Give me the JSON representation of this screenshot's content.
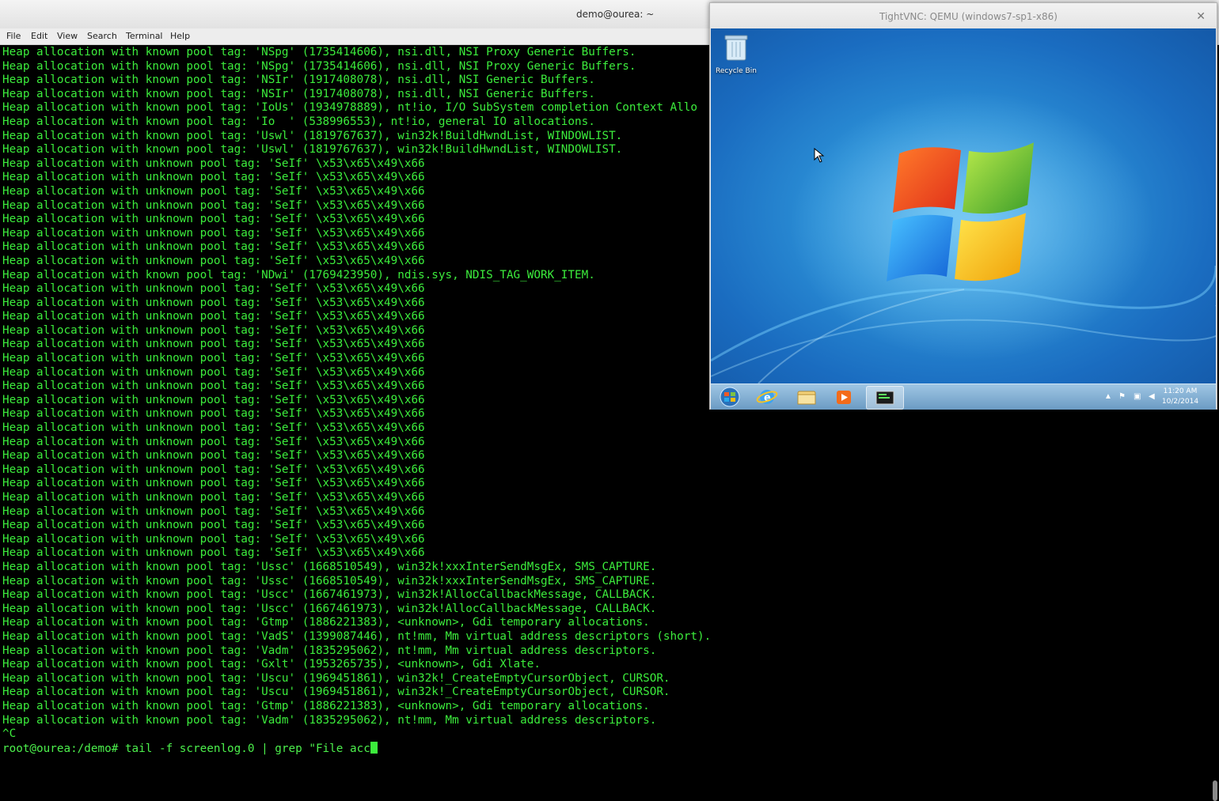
{
  "terminal": {
    "title": "demo@ourea: ~",
    "menu": [
      "File",
      "Edit",
      "View",
      "Search",
      "Terminal",
      "Help"
    ],
    "lines": [
      "Heap allocation with known pool tag: 'NSpg' (1735414606), nsi.dll, NSI Proxy Generic Buffers.",
      "Heap allocation with known pool tag: 'NSpg' (1735414606), nsi.dll, NSI Proxy Generic Buffers.",
      "Heap allocation with known pool tag: 'NSIr' (1917408078), nsi.dll, NSI Generic Buffers.",
      "Heap allocation with known pool tag: 'NSIr' (1917408078), nsi.dll, NSI Generic Buffers.",
      "Heap allocation with known pool tag: 'IoUs' (1934978889), nt!io, I/O SubSystem completion Context Allo",
      "Heap allocation with known pool tag: 'Io  ' (538996553), nt!io, general IO allocations.",
      "Heap allocation with known pool tag: 'Uswl' (1819767637), win32k!BuildHwndList, WINDOWLIST.",
      "Heap allocation with known pool tag: 'Uswl' (1819767637), win32k!BuildHwndList, WINDOWLIST.",
      "Heap allocation with unknown pool tag: 'SeIf' \\x53\\x65\\x49\\x66",
      "Heap allocation with unknown pool tag: 'SeIf' \\x53\\x65\\x49\\x66",
      "Heap allocation with unknown pool tag: 'SeIf' \\x53\\x65\\x49\\x66",
      "Heap allocation with unknown pool tag: 'SeIf' \\x53\\x65\\x49\\x66",
      "Heap allocation with unknown pool tag: 'SeIf' \\x53\\x65\\x49\\x66",
      "Heap allocation with unknown pool tag: 'SeIf' \\x53\\x65\\x49\\x66",
      "Heap allocation with unknown pool tag: 'SeIf' \\x53\\x65\\x49\\x66",
      "Heap allocation with unknown pool tag: 'SeIf' \\x53\\x65\\x49\\x66",
      "Heap allocation with known pool tag: 'NDwi' (1769423950), ndis.sys, NDIS_TAG_WORK_ITEM.",
      "Heap allocation with unknown pool tag: 'SeIf' \\x53\\x65\\x49\\x66",
      "Heap allocation with unknown pool tag: 'SeIf' \\x53\\x65\\x49\\x66",
      "Heap allocation with unknown pool tag: 'SeIf' \\x53\\x65\\x49\\x66",
      "Heap allocation with unknown pool tag: 'SeIf' \\x53\\x65\\x49\\x66",
      "Heap allocation with unknown pool tag: 'SeIf' \\x53\\x65\\x49\\x66",
      "Heap allocation with unknown pool tag: 'SeIf' \\x53\\x65\\x49\\x66",
      "Heap allocation with unknown pool tag: 'SeIf' \\x53\\x65\\x49\\x66",
      "Heap allocation with unknown pool tag: 'SeIf' \\x53\\x65\\x49\\x66",
      "Heap allocation with unknown pool tag: 'SeIf' \\x53\\x65\\x49\\x66",
      "Heap allocation with unknown pool tag: 'SeIf' \\x53\\x65\\x49\\x66",
      "Heap allocation with unknown pool tag: 'SeIf' \\x53\\x65\\x49\\x66",
      "Heap allocation with unknown pool tag: 'SeIf' \\x53\\x65\\x49\\x66",
      "Heap allocation with unknown pool tag: 'SeIf' \\x53\\x65\\x49\\x66",
      "Heap allocation with unknown pool tag: 'SeIf' \\x53\\x65\\x49\\x66",
      "Heap allocation with unknown pool tag: 'SeIf' \\x53\\x65\\x49\\x66",
      "Heap allocation with unknown pool tag: 'SeIf' \\x53\\x65\\x49\\x66",
      "Heap allocation with unknown pool tag: 'SeIf' \\x53\\x65\\x49\\x66",
      "Heap allocation with unknown pool tag: 'SeIf' \\x53\\x65\\x49\\x66",
      "Heap allocation with unknown pool tag: 'SeIf' \\x53\\x65\\x49\\x66",
      "Heap allocation with unknown pool tag: 'SeIf' \\x53\\x65\\x49\\x66",
      "Heap allocation with known pool tag: 'Ussc' (1668510549), win32k!xxxInterSendMsgEx, SMS_CAPTURE.",
      "Heap allocation with known pool tag: 'Ussc' (1668510549), win32k!xxxInterSendMsgEx, SMS_CAPTURE.",
      "Heap allocation with known pool tag: 'Uscc' (1667461973), win32k!AllocCallbackMessage, CALLBACK.",
      "Heap allocation with known pool tag: 'Uscc' (1667461973), win32k!AllocCallbackMessage, CALLBACK.",
      "Heap allocation with known pool tag: 'Gtmp' (1886221383), <unknown>, Gdi temporary allocations.",
      "Heap allocation with known pool tag: 'VadS' (1399087446), nt!mm, Mm virtual address descriptors (short).",
      "Heap allocation with known pool tag: 'Vadm' (1835295062), nt!mm, Mm virtual address descriptors.",
      "Heap allocation with known pool tag: 'Gxlt' (1953265735), <unknown>, Gdi Xlate.",
      "Heap allocation with known pool tag: 'Uscu' (1969451861), win32k!_CreateEmptyCursorObject, CURSOR.",
      "Heap allocation with known pool tag: 'Uscu' (1969451861), win32k!_CreateEmptyCursorObject, CURSOR.",
      "Heap allocation with known pool tag: 'Gtmp' (1886221383), <unknown>, Gdi temporary allocations.",
      "Heap allocation with known pool tag: 'Vadm' (1835295062), nt!mm, Mm virtual address descriptors.",
      "^C"
    ],
    "prompt": "root@ourea:/demo# ",
    "command": "tail -f screenlog.0 | grep \"File acc"
  },
  "vnc": {
    "title": "TightVNC: QEMU (windows7-sp1-x86)",
    "desktop_icons": [
      {
        "label": "Recycle Bin",
        "icon": "recycle-bin-icon"
      }
    ],
    "taskbar": {
      "buttons": [
        "start-orb-icon",
        "internet-explorer-icon",
        "windows-explorer-icon",
        "media-player-icon",
        "terminal-app-icon"
      ],
      "time": "11:20 AM",
      "date": "10/2/2014"
    }
  },
  "colors": {
    "terminal_text": "#3cec3c",
    "terminal_bg": "#000000",
    "win7_desktop": "#1a6cc0"
  }
}
